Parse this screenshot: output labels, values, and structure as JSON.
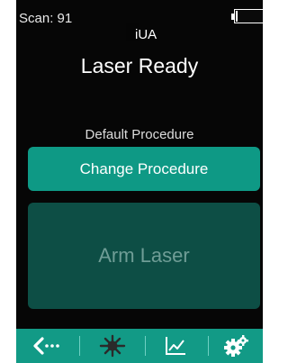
{
  "status": {
    "scan_text": "Scan: 91",
    "battery_type": "Li",
    "device_name": "iUA",
    "title": "Laser Ready"
  },
  "procedure": {
    "label": "Default Procedure",
    "change_button": "Change Procedure"
  },
  "arm_button": "Arm Laser",
  "navbar": {
    "icons": [
      "back-arrow-icon",
      "laser-burst-icon",
      "line-chart-icon",
      "gears-icon"
    ]
  },
  "colors": {
    "primary_button": "#0e9985",
    "disabled_button": "#0d4e45",
    "navbar": "#129a86",
    "battery_label": "#2d73d2"
  }
}
